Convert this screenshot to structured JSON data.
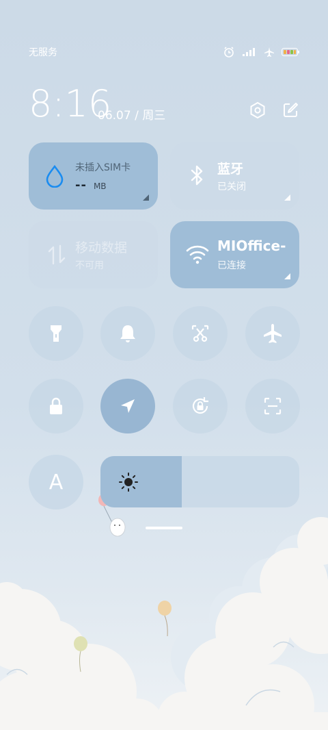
{
  "status_bar": {
    "carrier": "无服务",
    "icons": [
      "alarm-icon",
      "signal-icon",
      "airplane-mode-icon",
      "battery-icon"
    ]
  },
  "clock": {
    "time": "8:16",
    "date": "06.07 / 周三"
  },
  "top_actions": [
    "settings-icon",
    "edit-icon"
  ],
  "tiles": {
    "sim": {
      "title": "未插入SIM卡",
      "value": "--",
      "unit": "MB",
      "icon": "water-drop-icon"
    },
    "bluetooth": {
      "title": "蓝牙",
      "status": "已关闭",
      "icon": "bluetooth-icon"
    },
    "mobile_data": {
      "title": "移动数据",
      "status": "不可用",
      "icon": "mobile-data-icon"
    },
    "wifi": {
      "title": "MIOffice-",
      "status": "已连接",
      "icon": "wifi-icon"
    }
  },
  "toggles_row1": [
    "flashlight-icon",
    "bell-icon",
    "screenshot-icon",
    "airplane-icon"
  ],
  "toggles_row2": [
    "lock-icon",
    "location-icon",
    "rotation-lock-icon",
    "scanner-icon"
  ],
  "brightness": {
    "level": 0.41,
    "icon": "sun-icon"
  },
  "font_button": {
    "label": "A"
  },
  "colors": {
    "background": "#cbd9e6",
    "active": "#98b6d2",
    "inactive": "#c8d8e6"
  }
}
